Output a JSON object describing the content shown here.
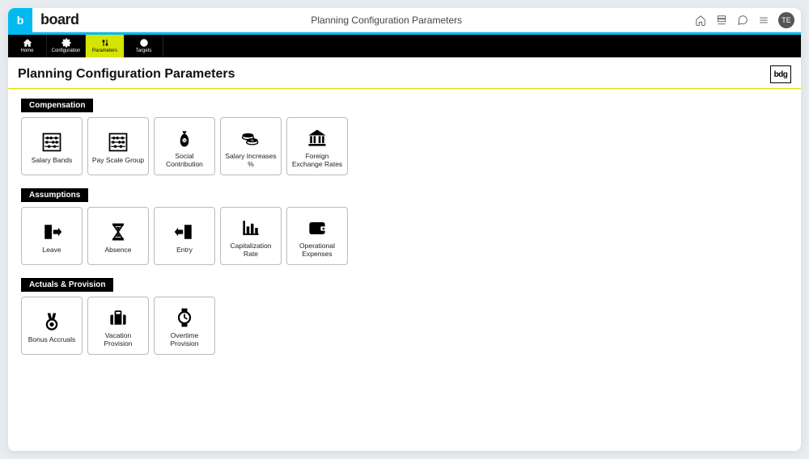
{
  "titlebar": {
    "logo_letter": "b",
    "brand": "board",
    "title": "Planning Configuration Parameters",
    "avatar_initials": "TE"
  },
  "nav": {
    "items": [
      {
        "label": "Home"
      },
      {
        "label": "Configuration"
      },
      {
        "label": "Parameters"
      },
      {
        "label": "Targets"
      }
    ]
  },
  "page": {
    "title": "Planning Configuration Parameters",
    "badge": "bdg"
  },
  "sections": [
    {
      "label": "Compensation",
      "cards": [
        {
          "label": "Salary Bands",
          "icon": "abacus"
        },
        {
          "label": "Pay Scale Group",
          "icon": "abacus"
        },
        {
          "label": "Social Contribution",
          "icon": "money-bag"
        },
        {
          "label": "Salary Increases %",
          "icon": "coins"
        },
        {
          "label": "Foreign Exchange Rates",
          "icon": "bank"
        }
      ]
    },
    {
      "label": "Assumptions",
      "cards": [
        {
          "label": "Leave",
          "icon": "door-out"
        },
        {
          "label": "Absence",
          "icon": "hourglass"
        },
        {
          "label": "Entry",
          "icon": "door-in"
        },
        {
          "label": "Capitalization Rate",
          "icon": "chart"
        },
        {
          "label": "Operational Expenses",
          "icon": "wallet"
        }
      ]
    },
    {
      "label": "Actuals & Provision",
      "cards": [
        {
          "label": "Bonus Accruals",
          "icon": "medal"
        },
        {
          "label": "Vacation Provision",
          "icon": "suitcase"
        },
        {
          "label": "Overtime Provision",
          "icon": "watch"
        }
      ]
    }
  ]
}
